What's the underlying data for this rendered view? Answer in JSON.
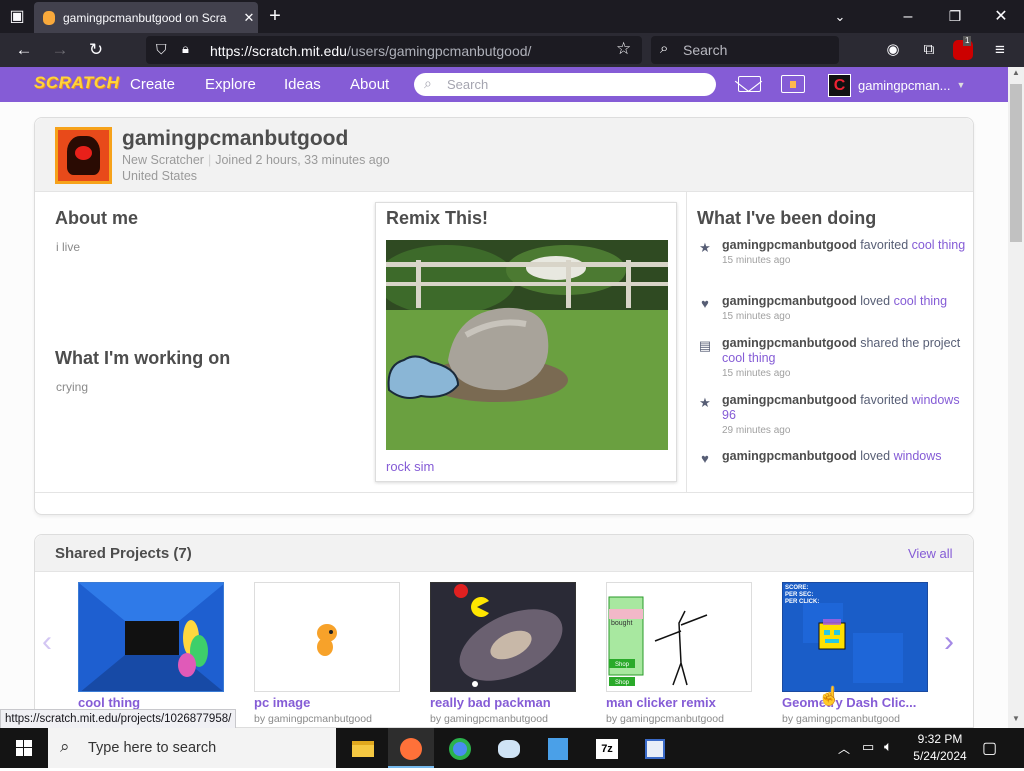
{
  "browser": {
    "tab_title": "gamingpcmanbutgood on Scra",
    "url_domain": "https://scratch.mit.edu",
    "url_path": "/users/gamingpcmanbutgood/",
    "search_placeholder": "Search",
    "ext_badge": "1"
  },
  "scratch_nav": {
    "logo": "SCRATCH",
    "items": [
      "Create",
      "Explore",
      "Ideas",
      "About"
    ],
    "search_placeholder": "Search",
    "user": "gamingpcman...",
    "avatar_letter": "C"
  },
  "profile": {
    "username": "gamingpcmanbutgood",
    "role": "New Scratcher",
    "joined": "Joined 2 hours, 33 minutes ago",
    "country": "United States",
    "about_heading": "About me",
    "about_text": "i live",
    "working_heading": "What I'm working on",
    "working_text": "crying",
    "remix_heading": "Remix This!",
    "remix_project": "rock sim",
    "activity_heading": "What I've been doing",
    "activity": [
      {
        "icon": "star-icon",
        "glyph": "★",
        "user": "gamingpcmanbutgood",
        "action": "favorited",
        "target": "cool thing",
        "time": "15 minutes ago"
      },
      {
        "icon": "heart-icon",
        "glyph": "♥",
        "user": "gamingpcmanbutgood",
        "action": "loved",
        "target": "cool thing",
        "time": "15 minutes ago"
      },
      {
        "icon": "share-icon",
        "glyph": "▤",
        "user": "gamingpcmanbutgood",
        "action": "shared the project",
        "target": "cool thing",
        "time": "15 minutes ago"
      },
      {
        "icon": "star-icon",
        "glyph": "★",
        "user": "gamingpcmanbutgood",
        "action": "favorited",
        "target": "windows 96",
        "time": "29 minutes ago"
      },
      {
        "icon": "heart-icon",
        "glyph": "♥",
        "user": "gamingpcmanbutgood",
        "action": "loved",
        "target": "windows",
        "time": ""
      }
    ]
  },
  "shared": {
    "title": "Shared Projects (7)",
    "view_all": "View all",
    "projects": [
      {
        "title": "cool thing",
        "by": ""
      },
      {
        "title": "pc image",
        "by": "by gamingpcmanbutgood"
      },
      {
        "title": "really bad packman",
        "by": "by gamingpcmanbutgood"
      },
      {
        "title": "man clicker remix",
        "by": "by gamingpcmanbutgood"
      },
      {
        "title": "Geometry Dash Clic...",
        "by": "by gamingpcmanbutgood"
      }
    ],
    "thumb_texts": {
      "clicker_bought": "bought",
      "clicker_shop": "Shop",
      "gd_score": "SCORE:",
      "gd_per_sec": "PER SEC:",
      "gd_per_click": "PER CLICK:"
    }
  },
  "status_url": "https://scratch.mit.edu/projects/1026877958/",
  "taskbar": {
    "search_placeholder": "Type here to search",
    "time": "9:32 PM",
    "date": "5/24/2024"
  },
  "colors": {
    "scratch_purple": "#855cd6",
    "browser_dark": "#1c1b22"
  }
}
